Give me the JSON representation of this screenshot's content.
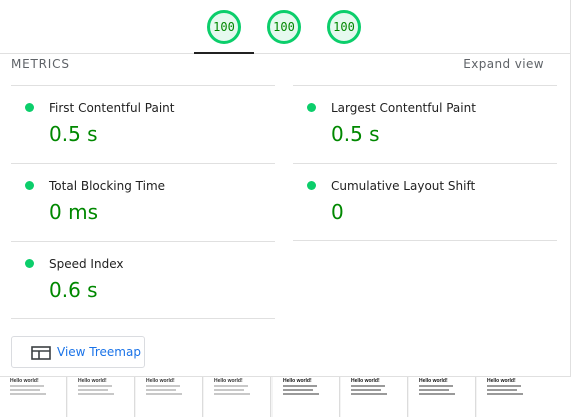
{
  "gauges": [
    {
      "label": "100",
      "score": 100
    },
    {
      "label": "100",
      "score": 100
    },
    {
      "label": "100",
      "score": 100
    }
  ],
  "metrics_section": {
    "title": "METRICS",
    "expand_label": "Expand view"
  },
  "metrics": {
    "fcp": {
      "label": "First Contentful Paint",
      "value": "0.5 s",
      "status": "pass"
    },
    "lcp": {
      "label": "Largest Contentful Paint",
      "value": "0.5 s",
      "status": "pass"
    },
    "tbt": {
      "label": "Total Blocking Time",
      "value": "0 ms",
      "status": "pass"
    },
    "cls": {
      "label": "Cumulative Layout Shift",
      "value": "0",
      "status": "pass"
    },
    "si": {
      "label": "Speed Index",
      "value": "0.6 s",
      "status": "pass"
    }
  },
  "treemap_button": {
    "label": "View Treemap",
    "icon": "treemap-icon"
  },
  "filmstrip": {
    "frame_title": "Hello world!"
  },
  "colors": {
    "pass": "#0cce6b",
    "pass_text": "#008800",
    "link": "#1a73e8"
  }
}
